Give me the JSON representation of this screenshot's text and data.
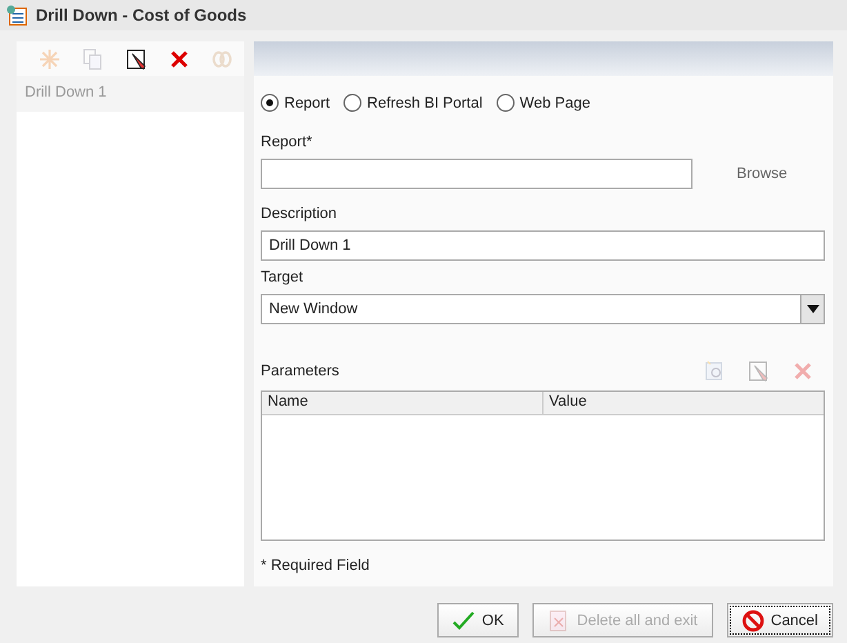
{
  "window": {
    "title": "Drill Down - Cost of Goods"
  },
  "toolbar": [
    {
      "kind": "new",
      "disabled": true
    },
    {
      "kind": "copy",
      "disabled": true
    },
    {
      "kind": "edit",
      "disabled": false
    },
    {
      "kind": "delete",
      "disabled": false
    },
    {
      "kind": "link",
      "disabled": true
    }
  ],
  "drilldowns": [
    {
      "label": "Drill Down 1"
    }
  ],
  "target_types": [
    {
      "label": "Report",
      "selected": true
    },
    {
      "label": "Refresh BI Portal",
      "selected": false
    },
    {
      "label": "Web Page",
      "selected": false
    }
  ],
  "report": {
    "label": "Report*",
    "browse": "Browse"
  },
  "description": {
    "label": "Description",
    "value": "Drill Down 1"
  },
  "target": {
    "label": "Target",
    "value": "New Window"
  },
  "parameters": {
    "label": "Parameters",
    "tools": [
      {
        "kind": "add",
        "disabled": true
      },
      {
        "kind": "edit",
        "disabled": true
      },
      {
        "kind": "delete",
        "disabled": true
      }
    ],
    "columns": [
      "Name",
      "Value"
    ]
  },
  "footnote": "* Required Field",
  "buttons": [
    {
      "kind": "ok",
      "label": "OK",
      "disabled": false,
      "focused": false
    },
    {
      "kind": "delete",
      "label": "Delete all and exit",
      "disabled": true,
      "focused": false
    },
    {
      "kind": "cancel",
      "label": "Cancel",
      "disabled": false,
      "focused": true
    }
  ]
}
